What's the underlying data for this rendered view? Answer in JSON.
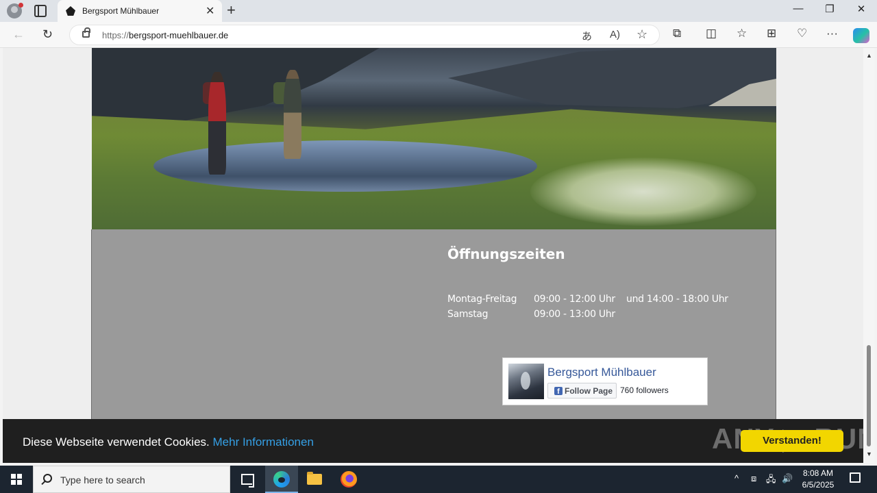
{
  "browser": {
    "tab": {
      "title": "Bergsport Mühlbauer"
    },
    "address": {
      "scheme": "https://",
      "host": "bergsport-muehlbauer.de"
    },
    "icons": {
      "back": "back-arrow-icon",
      "reload": "reload-icon",
      "translate": "translate-icon",
      "read_aloud": "read-aloud-icon",
      "favorite": "star-icon",
      "extensions": "puzzle-icon",
      "split": "split-screen-icon",
      "favorites_bar": "favorites-icon",
      "collections": "collections-icon",
      "performance": "heart-pulse-icon",
      "more": "more-icon",
      "copilot": "copilot-icon"
    },
    "glyphs": {
      "tab_close": "✕",
      "new_tab": "+",
      "minimize": "—",
      "restore": "❐",
      "close": "✕",
      "back": "←",
      "reload": "↻",
      "translate": "あ",
      "read_aloud": "A)",
      "favorite": "☆",
      "extensions": "⧉",
      "split": "◫",
      "favorites_bar": "☆",
      "collections": "⊞",
      "performance": "♡",
      "more": "···",
      "scroll_up": "▲",
      "scroll_down": "▼"
    }
  },
  "page": {
    "hours": {
      "title": "Öffnungszeiten",
      "rows": [
        {
          "day": "Montag-Freitag",
          "morning": "09:00 - 12:00 Uhr",
          "afternoon": "und 14:00 - 18:00 Uhr"
        },
        {
          "day": "Samstag",
          "morning": "09:00 - 13:00 Uhr",
          "afternoon": ""
        }
      ]
    },
    "facebook": {
      "page_name": "Bergsport Mühlbauer",
      "follow_label": "Follow Page",
      "followers": "760 followers",
      "logo": "f"
    },
    "cookie": {
      "text": "Diese Webseite verwendet Cookies.",
      "link": "Mehr Informationen",
      "button": "Verstanden!"
    },
    "watermark": "ANY ▷ RUN"
  },
  "taskbar": {
    "search_placeholder": "Type here to search",
    "time": "8:08 AM",
    "date": "6/5/2025",
    "tray": {
      "chevron": "^",
      "network": "🖧",
      "volume": "🔊",
      "meet": "⧈"
    }
  },
  "colors": {
    "content_bg": "#9a9a9a",
    "cookie_bar": "#1f1f1f",
    "cookie_link": "#35a0e6",
    "cookie_button": "#f2d600",
    "facebook_blue": "#365899"
  }
}
